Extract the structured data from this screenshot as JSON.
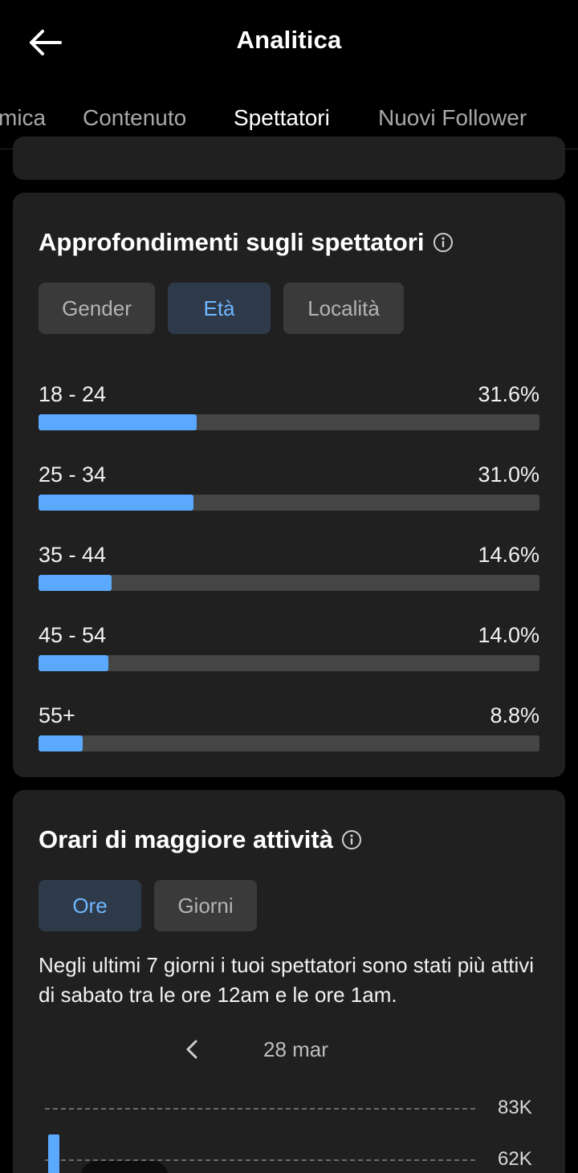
{
  "header": {
    "title": "Analitica",
    "back_icon": "arrow-left-icon"
  },
  "tabs": [
    {
      "label": "mica",
      "active": false
    },
    {
      "label": "Contenuto",
      "active": false
    },
    {
      "label": "Spettatori",
      "active": true
    },
    {
      "label": "Nuovi Follower",
      "active": false
    }
  ],
  "audience": {
    "title": "Approfondimenti sugli spettatori",
    "filters": [
      {
        "label": "Gender",
        "active": false
      },
      {
        "label": "Età",
        "active": true
      },
      {
        "label": "Località",
        "active": false
      }
    ],
    "ages": [
      {
        "range": "18 - 24",
        "percent_text": "31.6%",
        "percent": 31.6
      },
      {
        "range": "25 - 34",
        "percent_text": "31.0%",
        "percent": 31.0
      },
      {
        "range": "35 - 44",
        "percent_text": "14.6%",
        "percent": 14.6
      },
      {
        "range": "45 - 54",
        "percent_text": "14.0%",
        "percent": 14.0
      },
      {
        "range": "55+",
        "percent_text": "8.8%",
        "percent": 8.8
      }
    ]
  },
  "activity": {
    "title": "Orari di maggiore attività",
    "filters": [
      {
        "label": "Ore",
        "active": true
      },
      {
        "label": "Giorni",
        "active": false
      }
    ],
    "description": "Negli ultimi 7 giorni i tuoi spettatori sono stati più attivi di sabato tra le ore 12am e le ore 1am.",
    "date_label": "28 mar",
    "y_ticks": [
      "83K",
      "62K"
    ],
    "first_bar_value_k": 64
  },
  "colors": {
    "accent": "#5aa9ff",
    "card": "#202020",
    "pill_active_bg": "#2e3a4a",
    "pill_active_text": "#6fb6ff"
  }
}
